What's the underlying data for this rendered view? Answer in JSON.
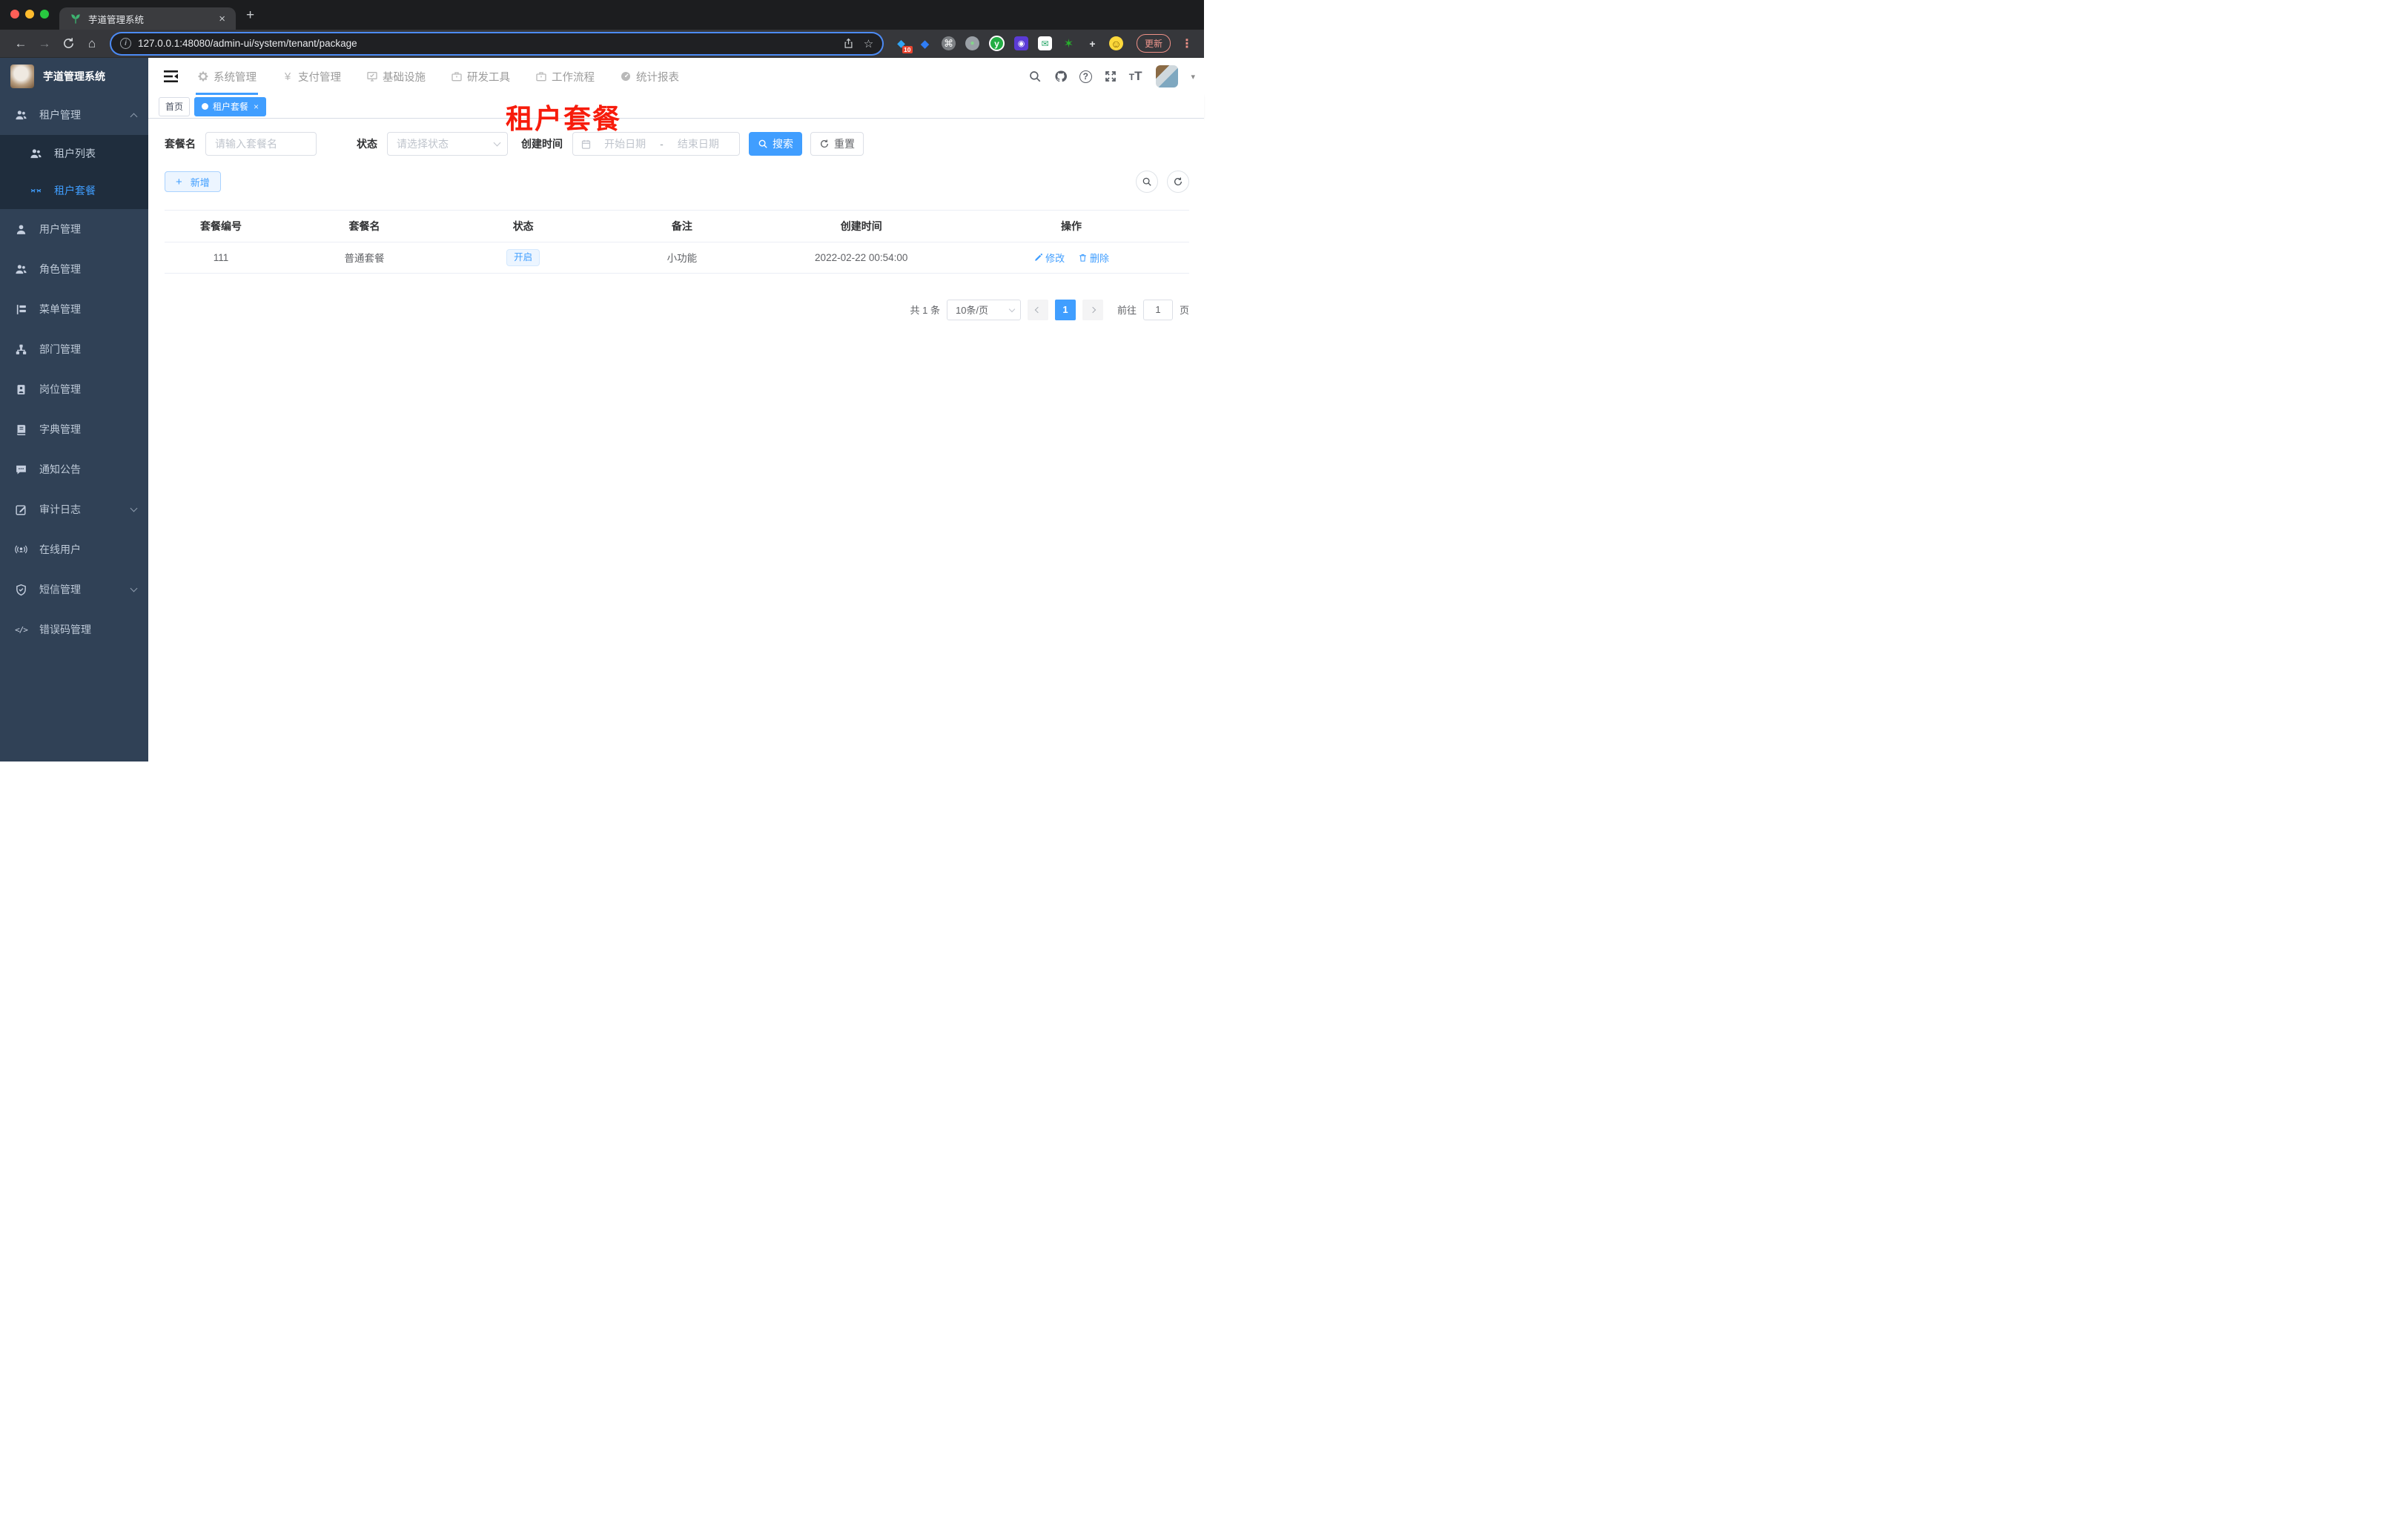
{
  "colors": {
    "accent": "#409eff",
    "sidebar_bg": "#304156",
    "submenu_bg": "#1f2d3d",
    "annotation_red": "#f71c0c",
    "status_tag_bg": "#ecf5ff",
    "search_button_bg": "#409eff"
  },
  "icons": {
    "back": "←",
    "forward": "→",
    "home": "⌂",
    "star": "☆",
    "ellipsis": "⋮",
    "caret_down": "▾",
    "close": "×",
    "new_tab": "+",
    "plus": "+",
    "command": "⌘",
    "smiley": "☺",
    "diamond": "◆",
    "gem": "◆",
    "dot": "●",
    "green_star": "✶",
    "envelope": "✉",
    "puzzle": "+",
    "shield_small": "◉",
    "y_letter": "y",
    "info": "i",
    "code": "</>",
    "date_separator": "-"
  },
  "browser": {
    "tab_title": "芋道管理系统",
    "url": "127.0.0.1:48080/admin-ui/system/tenant/package",
    "update_label": "更新",
    "extensions_badge": "10"
  },
  "header": {
    "logo_title": "芋道管理系统",
    "nav": [
      {
        "label": "系统管理"
      },
      {
        "label": "支付管理"
      },
      {
        "label": "基础设施"
      },
      {
        "label": "研发工具"
      },
      {
        "label": "工作流程"
      },
      {
        "label": "统计报表"
      }
    ]
  },
  "sidebar": {
    "items": [
      {
        "label": "租户管理"
      },
      {
        "label": "租户列表"
      },
      {
        "label": "租户套餐"
      },
      {
        "label": "用户管理"
      },
      {
        "label": "角色管理"
      },
      {
        "label": "菜单管理"
      },
      {
        "label": "部门管理"
      },
      {
        "label": "岗位管理"
      },
      {
        "label": "字典管理"
      },
      {
        "label": "通知公告"
      },
      {
        "label": "审计日志"
      },
      {
        "label": "在线用户"
      },
      {
        "label": "短信管理"
      },
      {
        "label": "错误码管理"
      }
    ]
  },
  "tags": {
    "items": [
      {
        "label": "首页"
      },
      {
        "label": "租户套餐"
      }
    ]
  },
  "annotation": {
    "text": "租户套餐"
  },
  "filter": {
    "name_label": "套餐名",
    "name_placeholder": "请输入套餐名",
    "status_label": "状态",
    "status_placeholder": "请选择状态",
    "date_label": "创建时间",
    "date_start_placeholder": "开始日期",
    "date_end_placeholder": "结束日期",
    "search_label": "搜索",
    "reset_label": "重置"
  },
  "actions": {
    "add_label": "新增"
  },
  "table": {
    "columns": [
      "套餐编号",
      "套餐名",
      "状态",
      "备注",
      "创建时间",
      "操作"
    ],
    "rows": [
      {
        "id": "111",
        "name": "普通套餐",
        "status": "开启",
        "remark": "小功能",
        "created": "2022-02-22 00:54:00",
        "edit": "修改",
        "delete": "删除"
      }
    ]
  },
  "pagination": {
    "total": "共 1 条",
    "page_size": "10条/页",
    "current_page": "1",
    "goto_label": "前往",
    "goto_value": "1",
    "page_unit": "页"
  }
}
